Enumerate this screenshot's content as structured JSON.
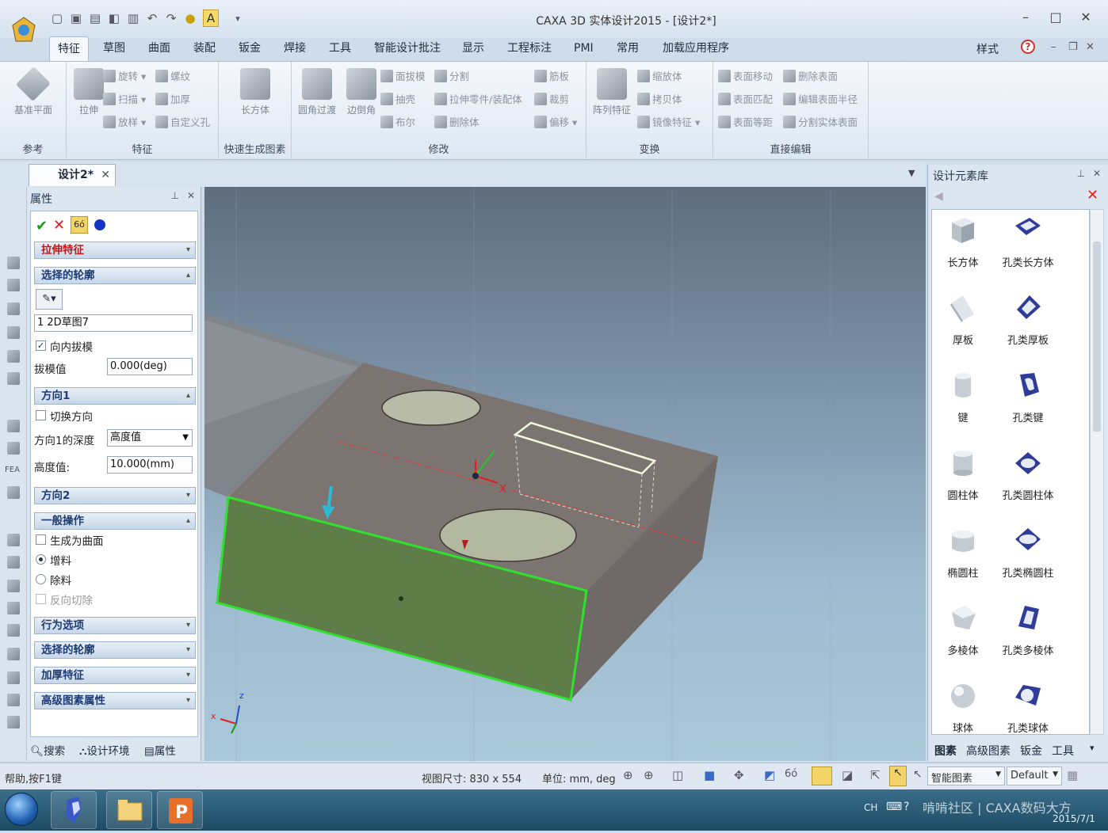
{
  "app": {
    "title": "CAXA 3D 实体设计2015 - [设计2*]"
  },
  "ribbon_tabs": [
    "特征",
    "草图",
    "曲面",
    "装配",
    "钣金",
    "焊接",
    "工具",
    "智能设计批注",
    "显示",
    "工程标注",
    "PMI",
    "常用",
    "加载应用程序"
  ],
  "style_label": "样式",
  "ribbon": {
    "groups": [
      {
        "label": "参考",
        "big": [
          "基准平面"
        ]
      },
      {
        "label": "特征",
        "big": [
          "拉伸"
        ],
        "small": [
          "旋转",
          "扫描",
          "放样",
          "螺纹",
          "加厚",
          "自定义孔"
        ]
      },
      {
        "label": "快速生成图素",
        "big": [
          "长方体"
        ]
      },
      {
        "label": "修改",
        "big": [
          "圆角过渡",
          "边倒角"
        ],
        "small": [
          "面拔模",
          "抽壳",
          "布尔",
          "分割",
          "拉伸零件/装配体",
          "删除体",
          "筋板",
          "裁剪",
          "偏移"
        ]
      },
      {
        "label": "变换",
        "big": [
          "阵列特征"
        ],
        "small": [
          "缩放体",
          "拷贝体",
          "镜像特征"
        ]
      },
      {
        "label": "直接编辑",
        "small": [
          "表面移动",
          "表面匹配",
          "表面等距",
          "删除表面",
          "编辑表面半径",
          "分割实体表面"
        ]
      }
    ]
  },
  "doc_tab": "设计2*",
  "properties": {
    "header": "属性",
    "feature_title": "拉伸特征",
    "sections": {
      "selected_profile": "选择的轮廓",
      "direction1": "方向1",
      "direction2": "方向2",
      "general_ops": "一般操作",
      "behavior": "行为选项",
      "selected_profile2": "选择的轮廓",
      "thicken": "加厚特征",
      "advanced": "高级图素属性"
    },
    "profile_item": "1   2D草图7",
    "inward_draft_label": "向内拔模",
    "draft_label": "拔模值",
    "draft_value": "0.000(deg)",
    "switch_dir_label": "切换方向",
    "depth_label": "方向1的深度",
    "depth_mode": "高度值",
    "height_label": "高度值:",
    "height_value": "10.000(mm)",
    "gen_surface": "生成为曲面",
    "add_material": "增料",
    "remove_material": "除料",
    "reverse_cut": "反向切除",
    "bottom_tabs": [
      "搜索",
      "设计环境",
      "属性"
    ]
  },
  "library": {
    "header": "设计元素库",
    "items": [
      [
        "长方体",
        "孔类长方体"
      ],
      [
        "厚板",
        "孔类厚板"
      ],
      [
        "键",
        "孔类键"
      ],
      [
        "圆柱体",
        "孔类圆柱体"
      ],
      [
        "椭圆柱",
        "孔类椭圆柱"
      ],
      [
        "多棱体",
        "孔类多棱体"
      ],
      [
        "球体",
        "孔类球体"
      ]
    ],
    "bottom_tabs": [
      "图素",
      "高级图素",
      "钣金",
      "工具"
    ]
  },
  "status": {
    "help": "帮助,按F1键",
    "view_size": "视图尺寸: 830 x 554",
    "units": "单位: mm, deg",
    "smart": "智能图素",
    "default": "Default"
  },
  "taskbar": {
    "lang": "CH",
    "watermark": "啃啃社区 | CAXA数码大方",
    "date": "2015/7/1"
  },
  "axes": {
    "x": "x",
    "z": "z"
  }
}
